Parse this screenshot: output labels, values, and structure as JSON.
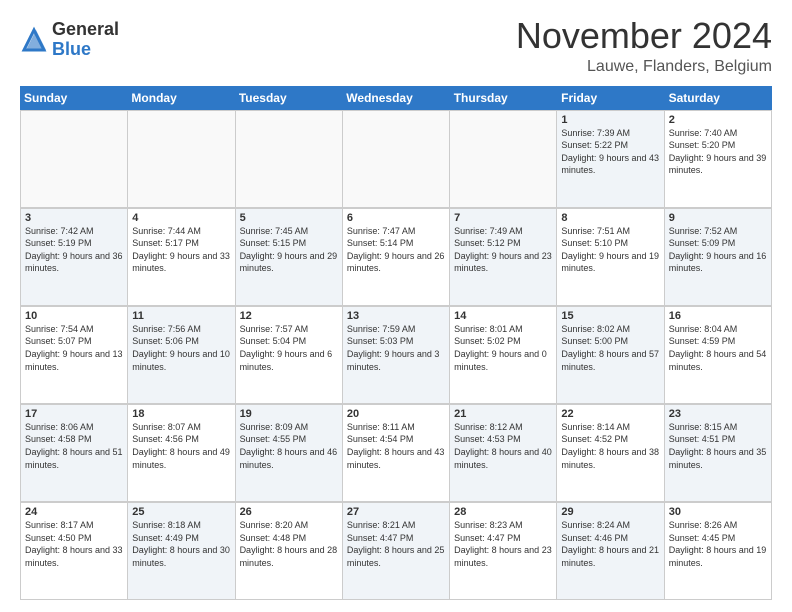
{
  "logo": {
    "general": "General",
    "blue": "Blue"
  },
  "header": {
    "month": "November 2024",
    "location": "Lauwe, Flanders, Belgium"
  },
  "weekdays": [
    "Sunday",
    "Monday",
    "Tuesday",
    "Wednesday",
    "Thursday",
    "Friday",
    "Saturday"
  ],
  "rows": [
    [
      {
        "day": "",
        "sunrise": "",
        "sunset": "",
        "daylight": "",
        "empty": true
      },
      {
        "day": "",
        "sunrise": "",
        "sunset": "",
        "daylight": "",
        "empty": true
      },
      {
        "day": "",
        "sunrise": "",
        "sunset": "",
        "daylight": "",
        "empty": true
      },
      {
        "day": "",
        "sunrise": "",
        "sunset": "",
        "daylight": "",
        "empty": true
      },
      {
        "day": "",
        "sunrise": "",
        "sunset": "",
        "daylight": "",
        "empty": true
      },
      {
        "day": "1",
        "sunrise": "Sunrise: 7:39 AM",
        "sunset": "Sunset: 5:22 PM",
        "daylight": "Daylight: 9 hours and 43 minutes.",
        "shaded": true
      },
      {
        "day": "2",
        "sunrise": "Sunrise: 7:40 AM",
        "sunset": "Sunset: 5:20 PM",
        "daylight": "Daylight: 9 hours and 39 minutes.",
        "shaded": false
      }
    ],
    [
      {
        "day": "3",
        "sunrise": "Sunrise: 7:42 AM",
        "sunset": "Sunset: 5:19 PM",
        "daylight": "Daylight: 9 hours and 36 minutes.",
        "shaded": true
      },
      {
        "day": "4",
        "sunrise": "Sunrise: 7:44 AM",
        "sunset": "Sunset: 5:17 PM",
        "daylight": "Daylight: 9 hours and 33 minutes.",
        "shaded": false
      },
      {
        "day": "5",
        "sunrise": "Sunrise: 7:45 AM",
        "sunset": "Sunset: 5:15 PM",
        "daylight": "Daylight: 9 hours and 29 minutes.",
        "shaded": true
      },
      {
        "day": "6",
        "sunrise": "Sunrise: 7:47 AM",
        "sunset": "Sunset: 5:14 PM",
        "daylight": "Daylight: 9 hours and 26 minutes.",
        "shaded": false
      },
      {
        "day": "7",
        "sunrise": "Sunrise: 7:49 AM",
        "sunset": "Sunset: 5:12 PM",
        "daylight": "Daylight: 9 hours and 23 minutes.",
        "shaded": true
      },
      {
        "day": "8",
        "sunrise": "Sunrise: 7:51 AM",
        "sunset": "Sunset: 5:10 PM",
        "daylight": "Daylight: 9 hours and 19 minutes.",
        "shaded": false
      },
      {
        "day": "9",
        "sunrise": "Sunrise: 7:52 AM",
        "sunset": "Sunset: 5:09 PM",
        "daylight": "Daylight: 9 hours and 16 minutes.",
        "shaded": true
      }
    ],
    [
      {
        "day": "10",
        "sunrise": "Sunrise: 7:54 AM",
        "sunset": "Sunset: 5:07 PM",
        "daylight": "Daylight: 9 hours and 13 minutes.",
        "shaded": false
      },
      {
        "day": "11",
        "sunrise": "Sunrise: 7:56 AM",
        "sunset": "Sunset: 5:06 PM",
        "daylight": "Daylight: 9 hours and 10 minutes.",
        "shaded": true
      },
      {
        "day": "12",
        "sunrise": "Sunrise: 7:57 AM",
        "sunset": "Sunset: 5:04 PM",
        "daylight": "Daylight: 9 hours and 6 minutes.",
        "shaded": false
      },
      {
        "day": "13",
        "sunrise": "Sunrise: 7:59 AM",
        "sunset": "Sunset: 5:03 PM",
        "daylight": "Daylight: 9 hours and 3 minutes.",
        "shaded": true
      },
      {
        "day": "14",
        "sunrise": "Sunrise: 8:01 AM",
        "sunset": "Sunset: 5:02 PM",
        "daylight": "Daylight: 9 hours and 0 minutes.",
        "shaded": false
      },
      {
        "day": "15",
        "sunrise": "Sunrise: 8:02 AM",
        "sunset": "Sunset: 5:00 PM",
        "daylight": "Daylight: 8 hours and 57 minutes.",
        "shaded": true
      },
      {
        "day": "16",
        "sunrise": "Sunrise: 8:04 AM",
        "sunset": "Sunset: 4:59 PM",
        "daylight": "Daylight: 8 hours and 54 minutes.",
        "shaded": false
      }
    ],
    [
      {
        "day": "17",
        "sunrise": "Sunrise: 8:06 AM",
        "sunset": "Sunset: 4:58 PM",
        "daylight": "Daylight: 8 hours and 51 minutes.",
        "shaded": true
      },
      {
        "day": "18",
        "sunrise": "Sunrise: 8:07 AM",
        "sunset": "Sunset: 4:56 PM",
        "daylight": "Daylight: 8 hours and 49 minutes.",
        "shaded": false
      },
      {
        "day": "19",
        "sunrise": "Sunrise: 8:09 AM",
        "sunset": "Sunset: 4:55 PM",
        "daylight": "Daylight: 8 hours and 46 minutes.",
        "shaded": true
      },
      {
        "day": "20",
        "sunrise": "Sunrise: 8:11 AM",
        "sunset": "Sunset: 4:54 PM",
        "daylight": "Daylight: 8 hours and 43 minutes.",
        "shaded": false
      },
      {
        "day": "21",
        "sunrise": "Sunrise: 8:12 AM",
        "sunset": "Sunset: 4:53 PM",
        "daylight": "Daylight: 8 hours and 40 minutes.",
        "shaded": true
      },
      {
        "day": "22",
        "sunrise": "Sunrise: 8:14 AM",
        "sunset": "Sunset: 4:52 PM",
        "daylight": "Daylight: 8 hours and 38 minutes.",
        "shaded": false
      },
      {
        "day": "23",
        "sunrise": "Sunrise: 8:15 AM",
        "sunset": "Sunset: 4:51 PM",
        "daylight": "Daylight: 8 hours and 35 minutes.",
        "shaded": true
      }
    ],
    [
      {
        "day": "24",
        "sunrise": "Sunrise: 8:17 AM",
        "sunset": "Sunset: 4:50 PM",
        "daylight": "Daylight: 8 hours and 33 minutes.",
        "shaded": false
      },
      {
        "day": "25",
        "sunrise": "Sunrise: 8:18 AM",
        "sunset": "Sunset: 4:49 PM",
        "daylight": "Daylight: 8 hours and 30 minutes.",
        "shaded": true
      },
      {
        "day": "26",
        "sunrise": "Sunrise: 8:20 AM",
        "sunset": "Sunset: 4:48 PM",
        "daylight": "Daylight: 8 hours and 28 minutes.",
        "shaded": false
      },
      {
        "day": "27",
        "sunrise": "Sunrise: 8:21 AM",
        "sunset": "Sunset: 4:47 PM",
        "daylight": "Daylight: 8 hours and 25 minutes.",
        "shaded": true
      },
      {
        "day": "28",
        "sunrise": "Sunrise: 8:23 AM",
        "sunset": "Sunset: 4:47 PM",
        "daylight": "Daylight: 8 hours and 23 minutes.",
        "shaded": false
      },
      {
        "day": "29",
        "sunrise": "Sunrise: 8:24 AM",
        "sunset": "Sunset: 4:46 PM",
        "daylight": "Daylight: 8 hours and 21 minutes.",
        "shaded": true
      },
      {
        "day": "30",
        "sunrise": "Sunrise: 8:26 AM",
        "sunset": "Sunset: 4:45 PM",
        "daylight": "Daylight: 8 hours and 19 minutes.",
        "shaded": false
      }
    ]
  ]
}
